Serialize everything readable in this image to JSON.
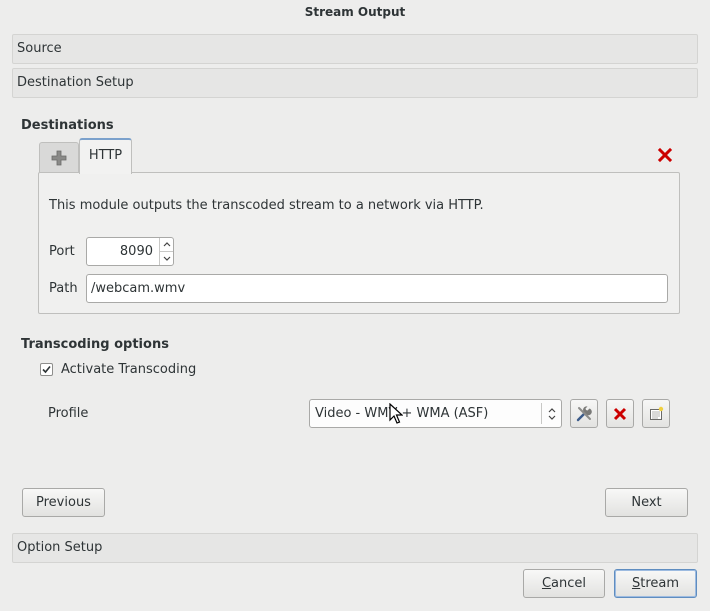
{
  "window": {
    "title": "Stream Output"
  },
  "sections": {
    "source": "Source",
    "destination_setup": "Destination Setup",
    "option_setup": "Option Setup"
  },
  "destinations": {
    "heading": "Destinations",
    "add_tab_icon": "plus-icon",
    "tabs": [
      {
        "label": "HTTP"
      }
    ],
    "close_icon": "red-x-icon",
    "description": "This module outputs the transcoded stream to a network via HTTP.",
    "port": {
      "label": "Port",
      "value": "8090"
    },
    "path": {
      "label": "Path",
      "value": "/webcam.wmv"
    }
  },
  "transcoding": {
    "heading": "Transcoding options",
    "activate": {
      "label": "Activate Transcoding",
      "checked": true
    },
    "profile": {
      "label": "Profile",
      "selected": "Video - WMV + WMA (ASF)",
      "edit_icon": "tools-icon",
      "delete_icon": "red-x-icon",
      "new_icon": "new-document-icon"
    }
  },
  "navigation": {
    "previous": "Previous",
    "next": "Next"
  },
  "footer": {
    "cancel": "Cancel",
    "stream": "Stream"
  },
  "colors": {
    "accent": "#7ba1cc",
    "delete_red": "#cc0000"
  }
}
